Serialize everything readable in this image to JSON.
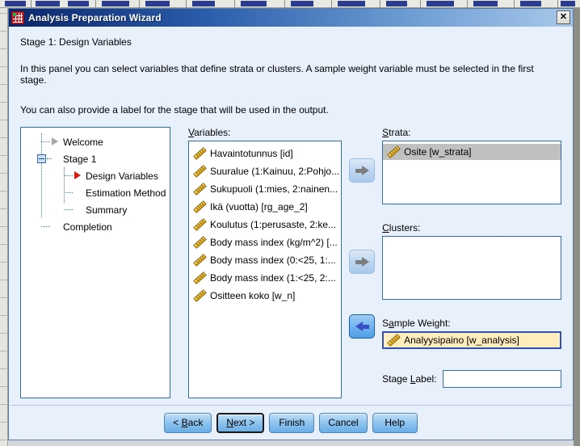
{
  "window": {
    "title": "Analysis Preparation Wizard",
    "icon": "spss-data-grid-icon",
    "close_label": "✕",
    "accent_color": "#2f6eb5",
    "titlebar_color": "#0a246a",
    "background_color": "#e8f0fb"
  },
  "header": {
    "stage_title": "Stage 1: Design Variables",
    "description_1": "In this panel you can select variables that define strata or clusters. A sample weight variable must be selected in the first stage.",
    "description_2": "You can also provide a label for the stage that will be used in the output."
  },
  "tree": {
    "items": [
      {
        "label": "Welcome",
        "marker": "triangle-gray",
        "level": 1
      },
      {
        "label": "Stage 1",
        "marker": "collapse-box",
        "level": 1
      },
      {
        "label": "Design Variables",
        "marker": "triangle-red",
        "level": 2
      },
      {
        "label": "Estimation Method",
        "marker": "none",
        "level": 2
      },
      {
        "label": "Summary",
        "marker": "none",
        "level": 2
      },
      {
        "label": "Completion",
        "marker": "none",
        "level": 1
      }
    ]
  },
  "variables": {
    "label": "Variables:",
    "mnemonic": "V",
    "items": [
      {
        "text": "Havaintotunnus [id]",
        "icon": "scale-ruler-icon"
      },
      {
        "text": "Suuralue (1:Kainuu, 2:Pohjo...",
        "icon": "scale-ruler-icon"
      },
      {
        "text": "Sukupuoli (1:mies, 2:nainen...",
        "icon": "scale-ruler-icon"
      },
      {
        "text": "Ikä (vuotta) [rg_age_2]",
        "icon": "scale-ruler-icon"
      },
      {
        "text": "Koulutus (1:perusaste, 2:ke...",
        "icon": "scale-ruler-icon"
      },
      {
        "text": "Body mass index (kg/m^2) [...",
        "icon": "scale-ruler-icon"
      },
      {
        "text": "Body mass index (0:<25, 1:...",
        "icon": "scale-ruler-icon"
      },
      {
        "text": "Body mass index (1:<25, 2:...",
        "icon": "scale-ruler-icon"
      },
      {
        "text": "Ositteen koko [w_n]",
        "icon": "scale-ruler-icon"
      }
    ]
  },
  "transfer_buttons": [
    {
      "name": "move-to-strata-button",
      "direction": "right",
      "enabled": false,
      "glyph": "arrow-right-icon"
    },
    {
      "name": "move-to-clusters-button",
      "direction": "right",
      "enabled": false,
      "glyph": "arrow-right-icon"
    },
    {
      "name": "move-weight-back-button",
      "direction": "left",
      "enabled": true,
      "glyph": "arrow-left-icon"
    }
  ],
  "strata": {
    "label": "Strata:",
    "mnemonic": "S",
    "items": [
      {
        "text": "Osite [w_strata]",
        "icon": "scale-ruler-icon",
        "selected": true
      }
    ]
  },
  "clusters": {
    "label": "Clusters:",
    "mnemonic": "C",
    "items": []
  },
  "sample_weight": {
    "label": "Sample Weight:",
    "mnemonic": "a",
    "value": "Analyysipaino [w_analysis]",
    "icon": "scale-ruler-icon",
    "field_color": "#ffedbe"
  },
  "stage_label": {
    "label": "Stage Label:",
    "mnemonic": "L",
    "value": "",
    "placeholder": ""
  },
  "footer": {
    "buttons": [
      {
        "name": "back-button",
        "label": "< Back",
        "mnemonic": "B",
        "focused": false
      },
      {
        "name": "next-button",
        "label": "Next >",
        "mnemonic": "N",
        "focused": true
      },
      {
        "name": "finish-button",
        "label": "Finish",
        "mnemonic": "",
        "focused": false
      },
      {
        "name": "cancel-button",
        "label": "Cancel",
        "mnemonic": "",
        "focused": false
      },
      {
        "name": "help-button",
        "label": "Help",
        "mnemonic": "",
        "focused": false
      }
    ]
  }
}
